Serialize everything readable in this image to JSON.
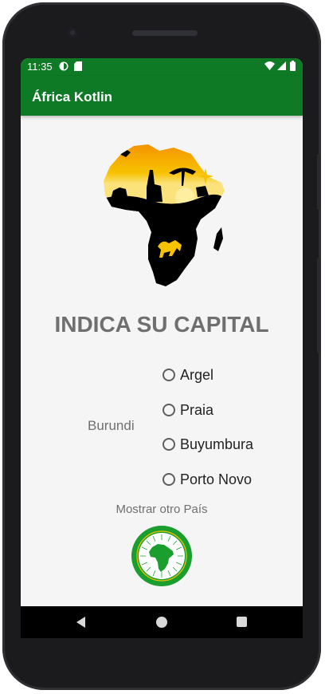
{
  "status_bar": {
    "time": "11:35",
    "icons": [
      "notification-icon",
      "sd-card-icon",
      "wifi-icon",
      "signal-icon",
      "battery-icon"
    ]
  },
  "app_bar": {
    "title": "África Kotlin"
  },
  "quiz": {
    "heading": "INDICA SU CAPITAL",
    "country": "Burundi",
    "options": [
      "Argel",
      "Praia",
      "Buyumbura",
      "Porto Novo"
    ],
    "another_label": "Mostrar otro País"
  },
  "colors": {
    "primary": "#0e7a26",
    "text_gray": "#6f6f6f",
    "emblem_green": "#1a9e2e",
    "sunset_yellow": "#f7c200"
  },
  "nav_bar": {
    "icons": [
      "back-icon",
      "home-icon",
      "recents-icon"
    ]
  }
}
